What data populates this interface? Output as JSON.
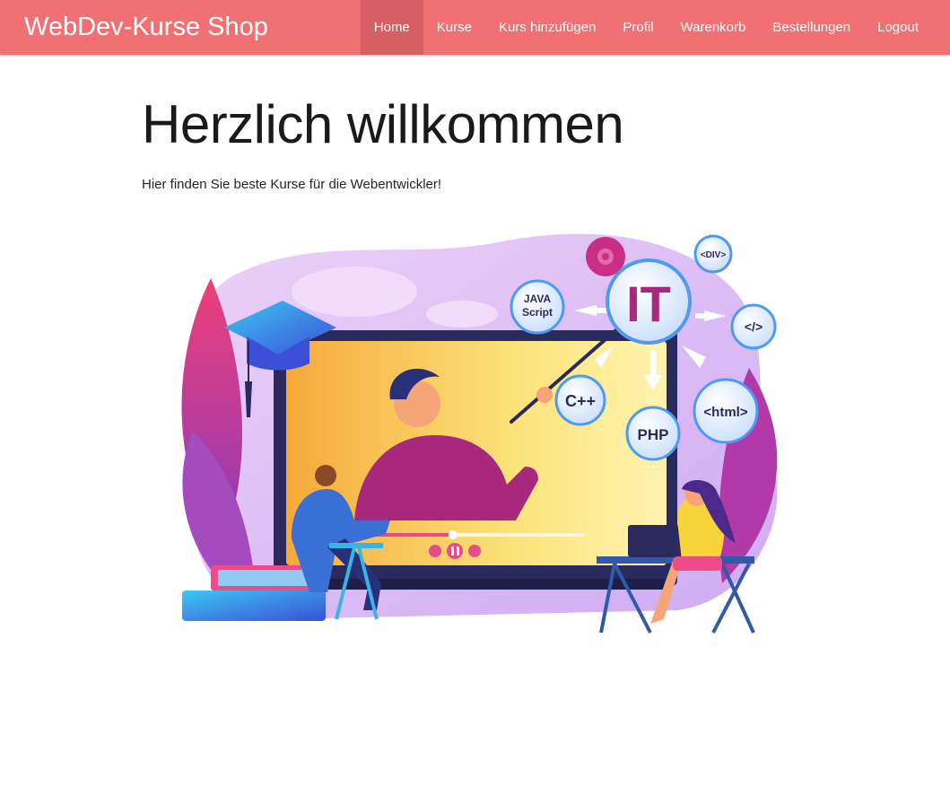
{
  "navbar": {
    "brand": "WebDev-Kurse Shop",
    "items": [
      {
        "label": "Home",
        "active": true
      },
      {
        "label": "Kurse"
      },
      {
        "label": "Kurs hinzufügen"
      },
      {
        "label": "Profil"
      },
      {
        "label": "Warenkorb"
      },
      {
        "label": "Bestellungen"
      },
      {
        "label": "Logout"
      }
    ]
  },
  "hero": {
    "title": "Herzlich willkommen",
    "subtitle": "Hier finden Sie beste Kurse für die Webentwickler!"
  },
  "illustration": {
    "bubbles": {
      "it": "IT",
      "js_line1": "JAVA",
      "js_line2": "Script",
      "cpp": "C++",
      "php": "PHP",
      "html": "<html>",
      "div": "<DIV>",
      "slash": "</>"
    }
  },
  "colors": {
    "navbar_bg": "#f07073",
    "navbar_active": "#d65f63",
    "text": "#212529"
  }
}
